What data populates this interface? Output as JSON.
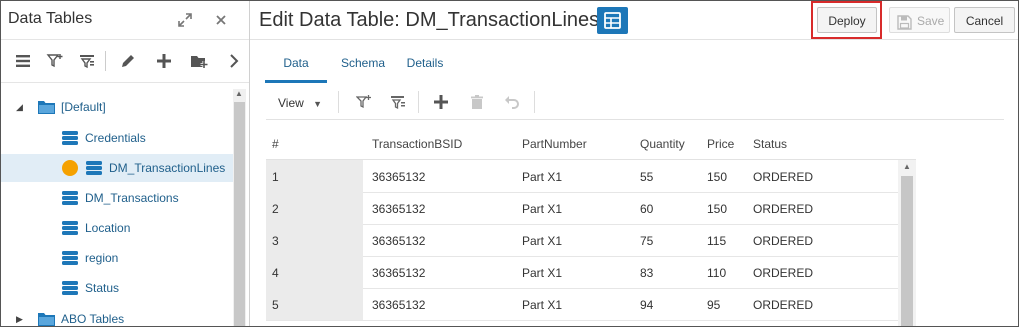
{
  "left_panel": {
    "title": "Data Tables",
    "tree": {
      "root_label": "[Default]",
      "items": [
        {
          "label": "Credentials"
        },
        {
          "label": "DM_TransactionLines"
        },
        {
          "label": "DM_Transactions"
        },
        {
          "label": "Location"
        },
        {
          "label": "region"
        },
        {
          "label": "Status"
        }
      ],
      "next_folder_label": "ABO Tables"
    }
  },
  "editor": {
    "title": "Edit Data Table: DM_TransactionLines",
    "deploy_label": "Deploy",
    "save_label": "Save",
    "cancel_label": "Cancel",
    "tabs": [
      "Data",
      "Schema",
      "Details"
    ],
    "active_tab": "Data",
    "view_label": "View"
  },
  "table": {
    "columns": [
      "#",
      "TransactionBSID",
      "PartNumber",
      "Quantity",
      "Price",
      "Status"
    ],
    "rows": [
      [
        "1",
        "36365132",
        "Part X1",
        "55",
        "150",
        "ORDERED"
      ],
      [
        "2",
        "36365132",
        "Part X1",
        "60",
        "150",
        "ORDERED"
      ],
      [
        "3",
        "36365132",
        "Part X1",
        "75",
        "115",
        "ORDERED"
      ],
      [
        "4",
        "36365132",
        "Part X1",
        "83",
        "110",
        "ORDERED"
      ],
      [
        "5",
        "36365132",
        "Part X1",
        "94",
        "95",
        "ORDERED"
      ]
    ]
  },
  "colors": {
    "accent": "#1d77b8",
    "link": "#1f5f8b",
    "highlight_outline": "#d82b2b",
    "status_dot": "#f5a100"
  }
}
